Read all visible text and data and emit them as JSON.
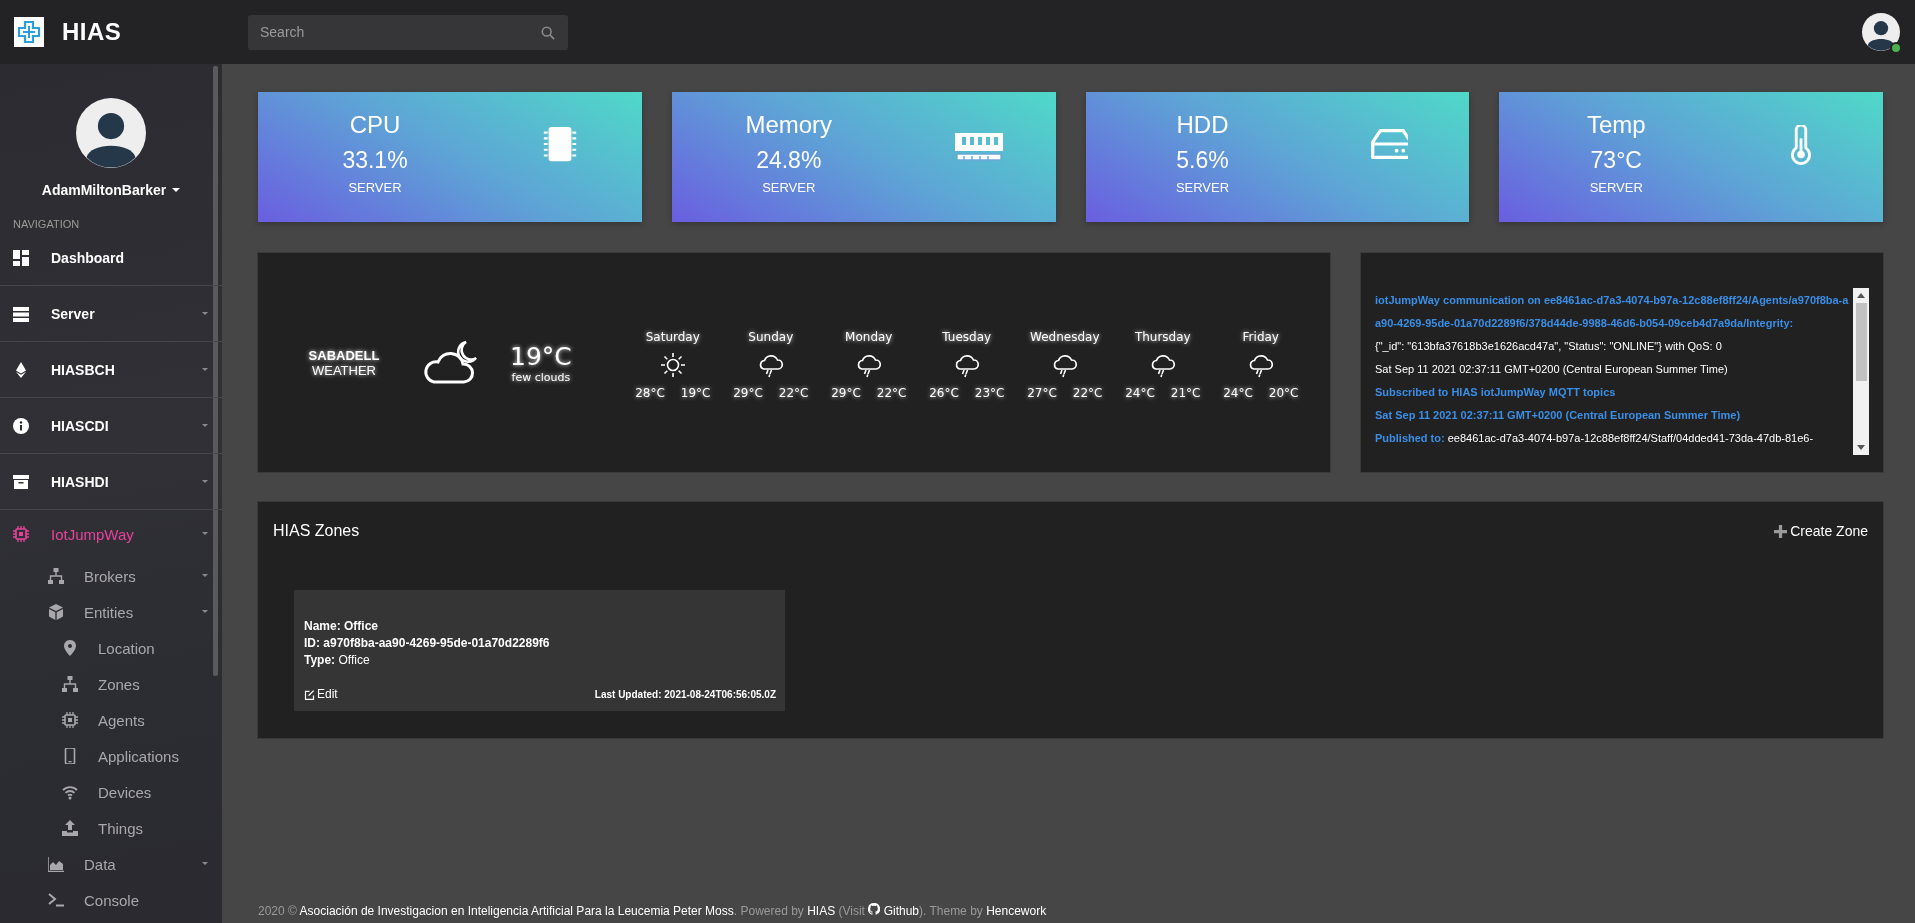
{
  "header": {
    "brand": "HIAS",
    "search": {
      "placeholder": "Search"
    },
    "user_online": true
  },
  "sidebar": {
    "user": "AdamMiltonBarker",
    "section": "NAVIGATION",
    "items": [
      {
        "label": "Dashboard",
        "selected": false,
        "has_submenu": false
      },
      {
        "label": "Server",
        "selected": false,
        "has_submenu": true
      },
      {
        "label": "HIASBCH",
        "selected": false,
        "has_submenu": true
      },
      {
        "label": "HIASCDI",
        "selected": false,
        "has_submenu": true
      },
      {
        "label": "HIASHDI",
        "selected": false,
        "has_submenu": true
      },
      {
        "label": "IotJumpWay",
        "selected": true,
        "has_submenu": true,
        "children": [
          {
            "label": "Brokers",
            "selected": false,
            "has_submenu": true
          },
          {
            "label": "Entities",
            "selected": false,
            "has_submenu": true,
            "children": [
              {
                "label": "Location",
                "selected": false,
                "has_submenu": false
              },
              {
                "label": "Zones",
                "selected": false,
                "has_submenu": false
              },
              {
                "label": "Agents",
                "selected": false,
                "has_submenu": false
              },
              {
                "label": "Applications",
                "selected": false,
                "has_submenu": false
              },
              {
                "label": "Devices",
                "selected": false,
                "has_submenu": false
              },
              {
                "label": "Things",
                "selected": false,
                "has_submenu": false
              }
            ]
          },
          {
            "label": "Data",
            "selected": false,
            "has_submenu": true
          },
          {
            "label": "Console",
            "selected": false,
            "has_submenu": false
          }
        ]
      }
    ]
  },
  "stats": [
    {
      "title": "CPU",
      "value": "33.1%",
      "caption": "SERVER",
      "kind": "cpu"
    },
    {
      "title": "Memory",
      "value": "24.8%",
      "caption": "SERVER",
      "kind": "memory"
    },
    {
      "title": "HDD",
      "value": "5.6%",
      "caption": "SERVER",
      "kind": "disk"
    },
    {
      "title": "Temp",
      "value": "73°C",
      "caption": "SERVER",
      "kind": "temperature"
    }
  ],
  "weather": {
    "city": "SABADELL",
    "label": "WEATHER",
    "current": {
      "kind": "cloudy-night",
      "temp": "19°C",
      "description": "few clouds"
    },
    "days": [
      {
        "day": "Saturday",
        "kind": "sun",
        "high": "28°C",
        "low": "19°C"
      },
      {
        "day": "Sunday",
        "kind": "rain",
        "high": "29°C",
        "low": "22°C"
      },
      {
        "day": "Monday",
        "kind": "rain",
        "high": "29°C",
        "low": "22°C"
      },
      {
        "day": "Tuesday",
        "kind": "rain",
        "high": "26°C",
        "low": "23°C"
      },
      {
        "day": "Wednesday",
        "kind": "rain",
        "high": "27°C",
        "low": "22°C"
      },
      {
        "day": "Thursday",
        "kind": "rain",
        "high": "24°C",
        "low": "21°C"
      },
      {
        "day": "Friday",
        "kind": "rain",
        "high": "24°C",
        "low": "20°C"
      }
    ]
  },
  "log": [
    {
      "kind": "topic",
      "text": "iotJumpWay communication on ee8461ac-d7a3-4074-b97a-12c88ef8ff24/Agents/a970f8ba-aa90-4269-95de-01a70d2289f6/378d44de-9988-46d6-b054-09ceb4d7a9da/Integrity:"
    },
    {
      "kind": "message",
      "text": "{\"_id\": \"613bfa37618b3e1626acd47a\", \"Status\": \"ONLINE\"} with QoS: 0"
    },
    {
      "kind": "message",
      "text": "Sat Sep 11 2021 02:37:11 GMT+0200 (Central European Summer Time)"
    },
    {
      "kind": "topic",
      "text": "Subscribed to HIAS iotJumpWay MQTT topics"
    },
    {
      "kind": "topic",
      "text": "Sat Sep 11 2021 02:37:11 GMT+0200 (Central European Summer Time)"
    },
    {
      "kind": "published",
      "label": "Published to:",
      "text": "ee8461ac-d7a3-4074-b97a-12c88ef8ff24/Staff/04dded41-73da-47db-81e6-"
    }
  ],
  "zones": {
    "title": "HIAS Zones",
    "create_button": "Create Zone",
    "cards": [
      {
        "lines": [
          {
            "text": "Name: Office",
            "bold": true
          },
          {
            "text": "ID: a970f8ba-aa90-4269-95de-01a70d2289f6",
            "bold": true
          },
          {
            "text": "**Type:** Office",
            "bold": false
          }
        ],
        "edit": "Edit",
        "updated": "Last Updated: 2021-08-24T06:56:05.0Z"
      }
    ]
  },
  "footer": [
    {
      "kind": "text",
      "text": "2020 © "
    },
    {
      "kind": "link",
      "text": "Asociación de Investigacion en Inteligencia Artificial Para la Leucemia Peter Moss"
    },
    {
      "kind": "text",
      "text": ". Powered by "
    },
    {
      "kind": "link",
      "text": "HIAS"
    },
    {
      "kind": "text",
      "text": " (Visit "
    },
    {
      "kind": "repo-link",
      "text": "Github"
    },
    {
      "kind": "text",
      "text": "). Theme by "
    },
    {
      "kind": "link",
      "text": "Hencework"
    }
  ]
}
